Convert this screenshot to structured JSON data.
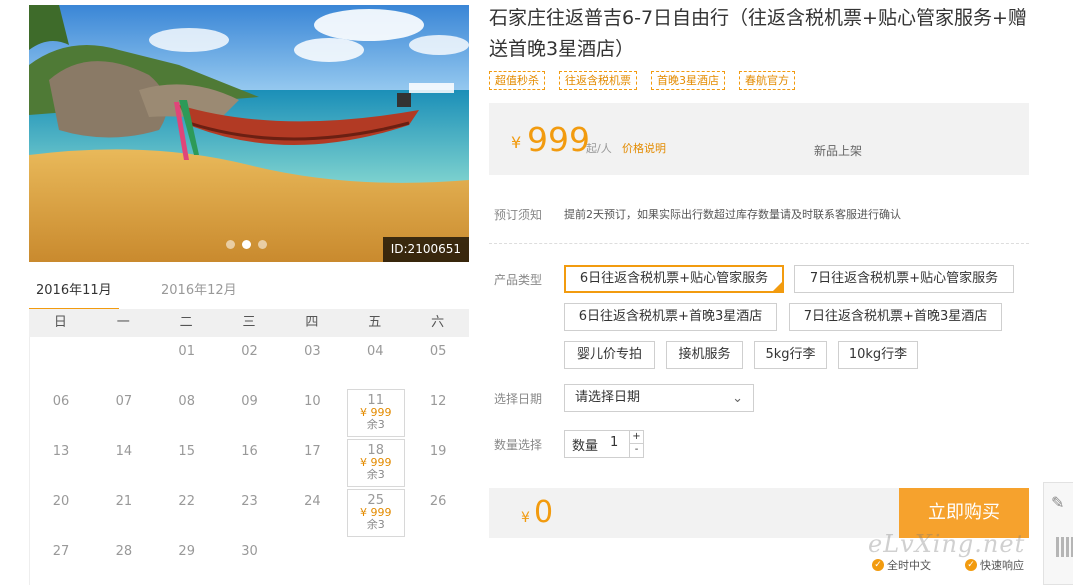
{
  "hero": {
    "id_label": "ID:2100651",
    "slide_count": 3,
    "active_slide": 2
  },
  "calendar": {
    "tabs": [
      "2016年11月",
      "2016年12月"
    ],
    "weekdays": [
      "日",
      "一",
      "二",
      "三",
      "四",
      "五",
      "六"
    ],
    "rows": [
      [
        {
          "d": ""
        },
        {
          "d": ""
        },
        {
          "d": "01"
        },
        {
          "d": "02"
        },
        {
          "d": "03"
        },
        {
          "d": "04"
        },
        {
          "d": "05"
        }
      ],
      [
        {
          "d": "06"
        },
        {
          "d": "07"
        },
        {
          "d": "08"
        },
        {
          "d": "09"
        },
        {
          "d": "10"
        },
        {
          "d": "11",
          "price": "¥ 999",
          "rest": "余3"
        },
        {
          "d": "12"
        }
      ],
      [
        {
          "d": "13"
        },
        {
          "d": "14"
        },
        {
          "d": "15"
        },
        {
          "d": "16"
        },
        {
          "d": "17"
        },
        {
          "d": "18",
          "price": "¥ 999",
          "rest": "余3"
        },
        {
          "d": "19"
        }
      ],
      [
        {
          "d": "20"
        },
        {
          "d": "21"
        },
        {
          "d": "22"
        },
        {
          "d": "23"
        },
        {
          "d": "24"
        },
        {
          "d": "25",
          "price": "¥ 999",
          "rest": "余3"
        },
        {
          "d": "26"
        }
      ],
      [
        {
          "d": "27"
        },
        {
          "d": "28"
        },
        {
          "d": "29"
        },
        {
          "d": "30"
        },
        {
          "d": ""
        },
        {
          "d": ""
        },
        {
          "d": ""
        }
      ]
    ]
  },
  "product": {
    "title": "石家庄往返普吉6-7日自由行（往返含税机票+贴心管家服务+赠送首晚3星酒店）",
    "tags": [
      "超值秒杀",
      "往返含税机票",
      "首晚3星酒店",
      "春航官方"
    ],
    "price": {
      "symbol": "¥",
      "value": "999",
      "unit": "起/人",
      "explain": "价格说明",
      "new_label": "新品上架"
    },
    "notice": {
      "label": "预订须知",
      "text": "提前2天预订，如果实际出行数超过库存数量请及时联系客服进行确认"
    },
    "type": {
      "label": "产品类型",
      "options": [
        "6日往返含税机票+贴心管家服务",
        "7日往返含税机票+贴心管家服务",
        "6日往返含税机票+首晚3星酒店",
        "7日往返含税机票+首晚3星酒店",
        "婴儿价专拍",
        "接机服务",
        "5kg行李",
        "10kg行李"
      ]
    },
    "date": {
      "label": "选择日期",
      "value": "请选择日期"
    },
    "quantity": {
      "label": "数量选择",
      "field_label": "数量",
      "value": "1",
      "plus": "+",
      "minus": "-"
    },
    "total": {
      "symbol": "¥",
      "value": "0"
    },
    "buy_label": "立即购买",
    "guarantees": [
      "全时中文",
      "快速响应"
    ]
  },
  "watermark": "eLvXing.net",
  "colors": {
    "accent": "#f29b0f",
    "button": "#f6a22d"
  }
}
